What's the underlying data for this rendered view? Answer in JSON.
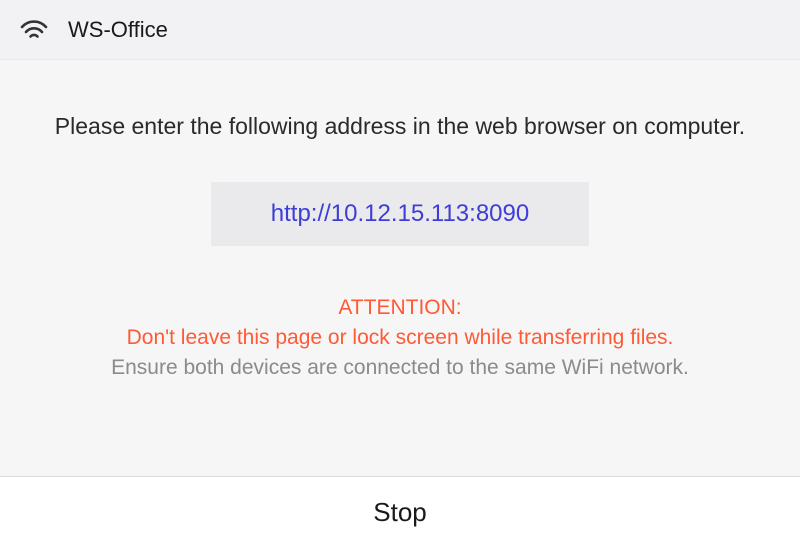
{
  "header": {
    "title": "WS-Office"
  },
  "content": {
    "instruction": "Please enter the following address in the web browser on computer.",
    "url": "http://10.12.15.113:8090",
    "attention_label": "ATTENTION:",
    "attention_text": "Don't leave this page or lock screen while transferring files.",
    "info_text": "Ensure both devices are connected to the same WiFi network."
  },
  "footer": {
    "stop_label": "Stop"
  }
}
